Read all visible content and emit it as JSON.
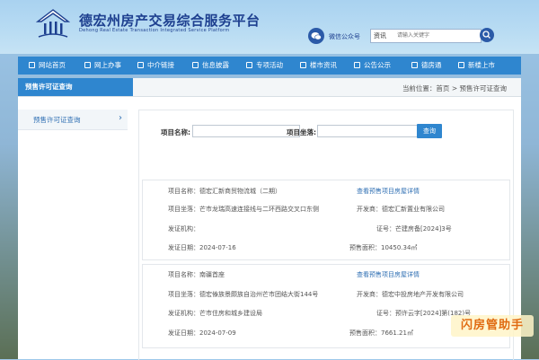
{
  "header": {
    "title": "德宏州房产交易综合服务平台",
    "subtitle": "Dehong Real Estate Transaction Integrated Service Platform",
    "wechat_label": "微信公众号",
    "search": {
      "category": "资讯",
      "placeholder": "请输入关键字"
    }
  },
  "nav": [
    {
      "label": "网站首页"
    },
    {
      "label": "网上办事"
    },
    {
      "label": "中介链接"
    },
    {
      "label": "信息披露"
    },
    {
      "label": "专项活动"
    },
    {
      "label": "楼市资讯"
    },
    {
      "label": "公告公示"
    },
    {
      "label": "德房通"
    },
    {
      "label": "新楼上市"
    }
  ],
  "page": {
    "section_title": "预售许可证查询",
    "breadcrumb": "当前位置：首页 > 预售许可证查询",
    "side_item": "预售许可证查询"
  },
  "form": {
    "name_label": "项目名称:",
    "location_label": "项目坐落:",
    "query_button": "查询"
  },
  "results": [
    {
      "name": "项目名称：德宏汇新商贸物流城（二期）",
      "detail_link": "查看预售项目房屋详情",
      "location": "项目坐落：芒市龙瑞高速连接线与二环西路交叉口东侧",
      "developer": "开发商：德宏汇新置业有限公司",
      "authority": "发证机构：",
      "cert_no": "证号：芒建房备[2024]3号",
      "issue_date": "发证日期：2024-07-16",
      "presale_area": "预售面积：10450.34㎡"
    },
    {
      "name": "项目名称：南疆首座",
      "detail_link": "查看预售项目房屋详情",
      "location": "项目坐落：德宏傣族景颇族自治州芒市团结大街144号",
      "developer": "开发商：德宏中投房地产开发有限公司",
      "authority": "发证机构：芒市住房和城乡建设局",
      "cert_no": "证号：预许云字[2024]第(182)号",
      "issue_date": "发证日期：2024-07-09",
      "presale_area": "预售面积：7661.21㎡"
    }
  ],
  "watermark": "闪房管助手",
  "colors": {
    "nav_blue": "#2f86cf",
    "title_blue": "#1d3f8f",
    "link_blue": "#2f6fb3"
  }
}
